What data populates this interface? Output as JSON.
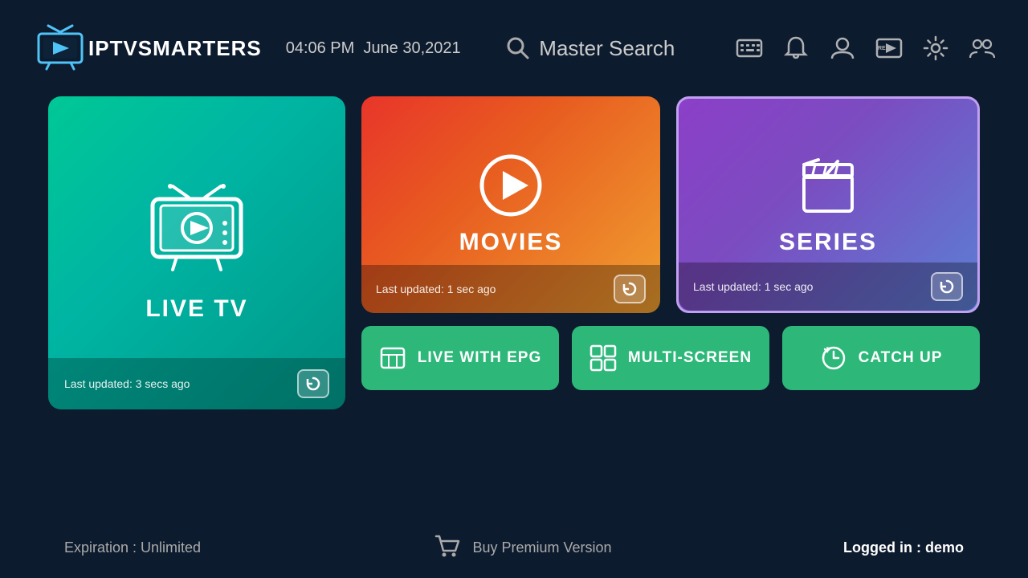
{
  "header": {
    "logo_iptv": "IPTV",
    "logo_smarters": "SMARTERS",
    "time": "04:06 PM",
    "date": "June 30,2021",
    "search_label": "Master Search"
  },
  "icons": {
    "keyboard": "⌨",
    "notification": "🔔",
    "user": "👤",
    "record": "REC",
    "settings": "⚙",
    "switch_user": "👥"
  },
  "cards": {
    "live_tv": {
      "title": "LIVE TV",
      "last_updated": "Last updated: 3 secs ago"
    },
    "movies": {
      "title": "MOVIES",
      "last_updated": "Last updated: 1 sec ago"
    },
    "series": {
      "title": "SERIES",
      "last_updated": "Last updated: 1 sec ago"
    }
  },
  "buttons": {
    "live_epg": "LIVE WITH EPG",
    "multi_screen": "MULTI-SCREEN",
    "catch_up": "CATCH UP"
  },
  "footer": {
    "expiration": "Expiration : Unlimited",
    "buy_premium": "Buy Premium Version",
    "logged_in_label": "Logged in : ",
    "logged_in_user": "demo"
  }
}
